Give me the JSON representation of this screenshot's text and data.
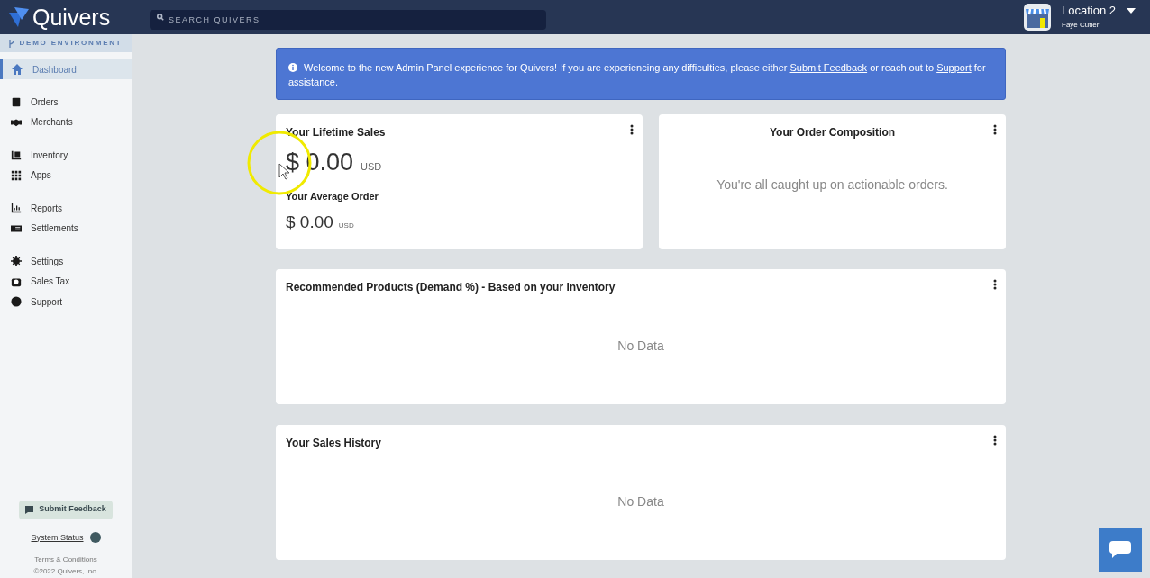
{
  "header": {
    "logo": "Quivers",
    "search": {
      "placeholder": "SEARCH QUIVERS"
    },
    "location": "Location 2",
    "user": "Faye Cutler"
  },
  "sidebar": {
    "environment": "DEMO ENVIRONMENT",
    "groups": [
      [
        {
          "label": "Dashboard",
          "selected": true
        }
      ],
      [
        {
          "label": "Orders",
          "selected": false
        },
        {
          "label": "Merchants",
          "selected": false
        }
      ],
      [
        {
          "label": "Inventory",
          "selected": false
        },
        {
          "label": "Apps",
          "selected": false
        }
      ],
      [
        {
          "label": "Reports",
          "selected": false
        },
        {
          "label": "Settlements",
          "selected": false
        }
      ],
      [
        {
          "label": "Settings",
          "selected": false
        },
        {
          "label": "Sales Tax",
          "selected": false
        },
        {
          "label": "Support",
          "selected": false
        }
      ]
    ],
    "feedback_button": "Submit Feedback",
    "system_status": "System Status",
    "terms": "Terms & Conditions",
    "copyright": "©2022 Quivers, Inc."
  },
  "banner": {
    "parts": [
      {
        "kind": "text",
        "text": "Welcome to the new Admin Panel experience for Quivers! If you are experiencing any difficulties, please either "
      },
      {
        "kind": "link",
        "text": "Submit Feedback"
      },
      {
        "kind": "text",
        "text": " or reach out to "
      },
      {
        "kind": "link",
        "text": "Support"
      },
      {
        "kind": "text",
        "text": " for assistance."
      }
    ]
  },
  "lifetime_sales": {
    "title": "Your Lifetime Sales",
    "amount": "$ 0.00",
    "currency": "USD",
    "average_title": "Your Average Order",
    "average_amount": "$ 0.00",
    "average_currency": "USD"
  },
  "order_composition": {
    "title": "Your Order Composition",
    "message": "You're all caught up on actionable orders."
  },
  "recommended_products": {
    "title": "Recommended Products (Demand %) - Based on your inventory",
    "message": "No Data"
  },
  "sales_history": {
    "title": "Your Sales History",
    "message": "No Data"
  }
}
